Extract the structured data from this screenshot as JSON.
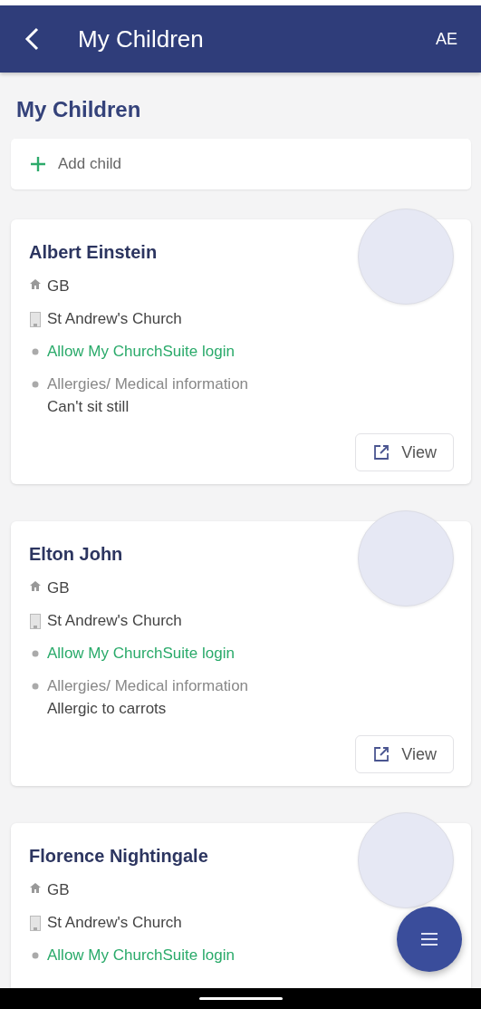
{
  "header": {
    "title": "My Children",
    "user_initials": "AE"
  },
  "page_title": "My Children",
  "add_child": {
    "label": "Add child"
  },
  "children": [
    {
      "name": "Albert Einstein",
      "rows": [
        {
          "kind": "country",
          "text": "GB"
        },
        {
          "kind": "church",
          "text": "St Andrew's Church"
        },
        {
          "kind": "login",
          "text": "Allow My ChurchSuite login"
        },
        {
          "kind": "medical",
          "text": "Allergies/ Medical information",
          "value": "Can't sit still"
        }
      ],
      "view_label": "View"
    },
    {
      "name": "Elton John",
      "rows": [
        {
          "kind": "country",
          "text": "GB"
        },
        {
          "kind": "church",
          "text": "St Andrew's Church"
        },
        {
          "kind": "login",
          "text": "Allow My ChurchSuite login"
        },
        {
          "kind": "medical",
          "text": "Allergies/ Medical information",
          "value": "Allergic to carrots"
        }
      ],
      "view_label": "View"
    },
    {
      "name": "Florence Nightingale",
      "rows": [
        {
          "kind": "country",
          "text": "GB"
        },
        {
          "kind": "church",
          "text": "St Andrew's Church"
        },
        {
          "kind": "login",
          "text": "Allow My ChurchSuite login"
        }
      ]
    }
  ]
}
